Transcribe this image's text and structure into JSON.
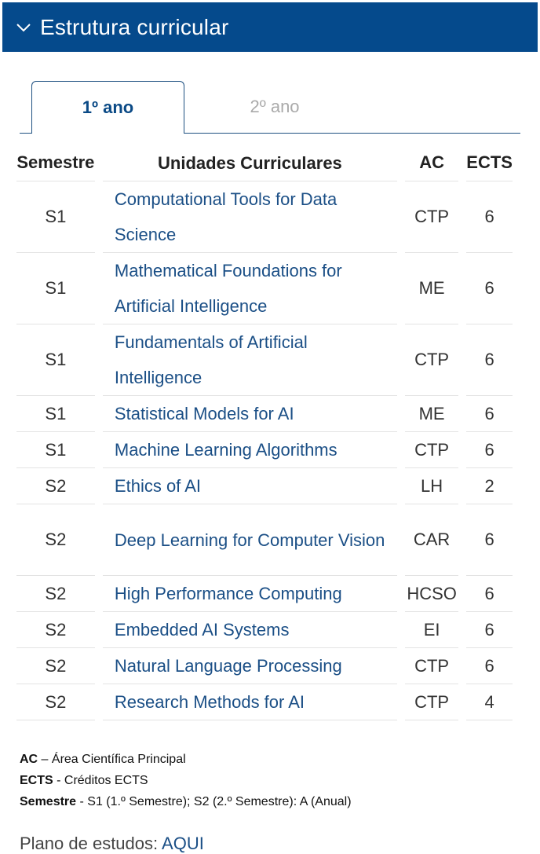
{
  "header": {
    "title": "Estrutura curricular",
    "icon": "chevron-down-icon",
    "color": "#054a8c"
  },
  "tabs": [
    {
      "label": "1º ano",
      "active": true
    },
    {
      "label": "2º ano",
      "active": false
    }
  ],
  "table": {
    "headers": {
      "semestre": "Semestre",
      "uc": "Unidades Curriculares",
      "ac": "AC",
      "ects": "ECTS"
    },
    "rows": [
      {
        "semestre": "S1",
        "uc": "Computational Tools for Data Science",
        "ac": "CTP",
        "ects": "6"
      },
      {
        "semestre": "S1",
        "uc": "Mathematical Foundations for Artificial Intelligence",
        "ac": "ME",
        "ects": "6"
      },
      {
        "semestre": "S1",
        "uc": "Fundamentals of Artificial Intelligence",
        "ac": "CTP",
        "ects": "6"
      },
      {
        "semestre": "S1",
        "uc": "Statistical Models for AI",
        "ac": "ME",
        "ects": "6"
      },
      {
        "semestre": "S1",
        "uc": "Machine Learning Algorithms",
        "ac": "CTP",
        "ects": "6"
      },
      {
        "semestre": "S2",
        "uc": "Ethics of AI",
        "ac": "LH",
        "ects": "2"
      },
      {
        "semestre": "S2",
        "uc": "Deep Learning for Computer Vision",
        "ac": "CAR",
        "ects": "6"
      },
      {
        "semestre": "S2",
        "uc": "High Performance Computing",
        "ac": "HCSO",
        "ects": "6"
      },
      {
        "semestre": "S2",
        "uc": "Embedded AI Systems",
        "ac": "EI",
        "ects": "6"
      },
      {
        "semestre": "S2",
        "uc": "Natural Language Processing",
        "ac": "CTP",
        "ects": "6"
      },
      {
        "semestre": "S2",
        "uc": "Research Methods for AI",
        "ac": "CTP",
        "ects": "4"
      }
    ]
  },
  "legend": [
    {
      "term": "AC",
      "text": " – Área Científica Principal"
    },
    {
      "term": "ECTS",
      "text": " - Créditos ECTS"
    },
    {
      "term": "Semestre",
      "text": " - S1 (1.º Semestre); S2 (2.º Semestre): A (Anual)"
    }
  ],
  "plan": {
    "label": "Plano de estudos: ",
    "link": "AQUI"
  }
}
